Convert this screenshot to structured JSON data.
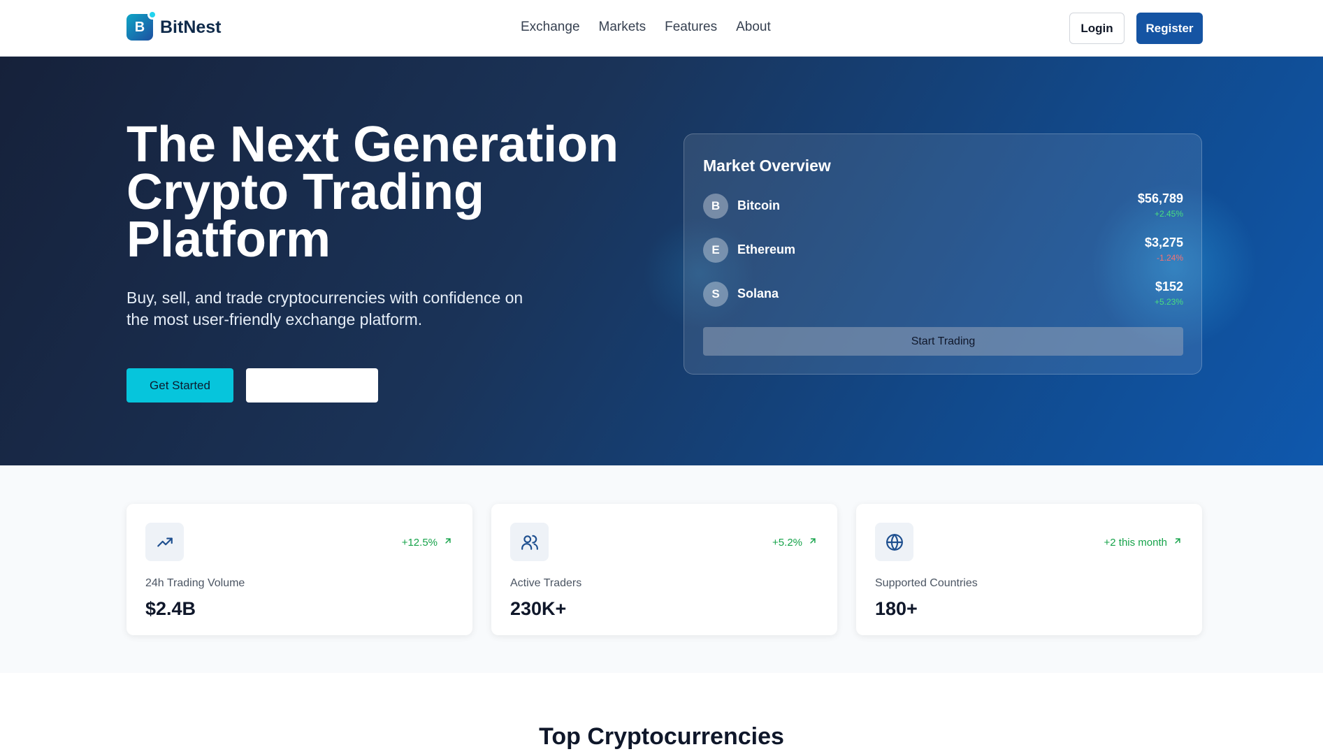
{
  "header": {
    "logo_letter": "B",
    "brand": "BitNest",
    "nav": [
      "Exchange",
      "Markets",
      "Features",
      "About"
    ],
    "login_label": "Login",
    "register_label": "Register"
  },
  "hero": {
    "title": "The Next Generation Crypto Trading Platform",
    "subtitle": "Buy, sell, and trade cryptocurrencies with confidence on the most user-friendly exchange platform.",
    "primary_button": "Get Started",
    "secondary_button": ""
  },
  "market": {
    "title": "Market Overview",
    "coins": [
      {
        "letter": "B",
        "name": "Bitcoin",
        "price": "$56,789",
        "change": "+2.45%",
        "direction": "up"
      },
      {
        "letter": "E",
        "name": "Ethereum",
        "price": "$3,275",
        "change": "-1.24%",
        "direction": "down"
      },
      {
        "letter": "S",
        "name": "Solana",
        "price": "$152",
        "change": "+5.23%",
        "direction": "up"
      }
    ],
    "button": "Start Trading"
  },
  "stats": [
    {
      "icon": "trending-up-icon",
      "change": "+12.5%",
      "label": "24h Trading Volume",
      "value": "$2.4B"
    },
    {
      "icon": "users-icon",
      "change": "+5.2%",
      "label": "Active Traders",
      "value": "230K+"
    },
    {
      "icon": "globe-icon",
      "change": "+2 this month",
      "label": "Supported Countries",
      "value": "180+"
    }
  ],
  "section": {
    "title": "Top Cryptocurrencies"
  },
  "colors": {
    "brand": "#1554a3",
    "accent": "#06c5dc",
    "positive": "#16a34a",
    "negative": "#f87171"
  }
}
